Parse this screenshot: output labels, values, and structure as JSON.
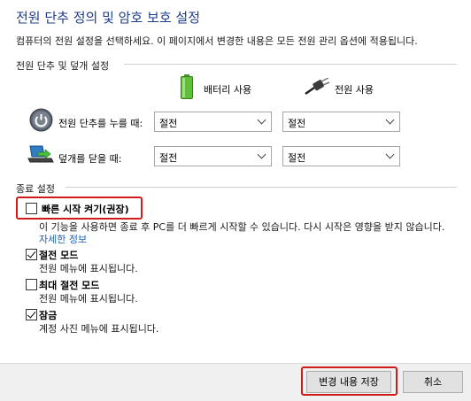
{
  "header": {
    "title": "전원 단추 정의 및 암호 보호 설정",
    "subtitle": "컴퓨터의 전원 설정을 선택하세요. 이 페이지에서 변경한 내용은 모든 전원 관리 옵션에 적용됩니다."
  },
  "power_section": {
    "heading": "전원 단추 및 덮개 설정",
    "col_battery": "배터리 사용",
    "col_plugged": "전원 사용",
    "rows": [
      {
        "label": "전원 단추를 누를 때:",
        "battery_value": "절전",
        "plugged_value": "절전",
        "icon": "power-button-icon"
      },
      {
        "label": "덮개를 닫을 때:",
        "battery_value": "절전",
        "plugged_value": "절전",
        "icon": "laptop-lid-icon"
      }
    ]
  },
  "shutdown_section": {
    "heading": "종료 설정",
    "fast_startup": {
      "label": "빠른 시작 켜기(권장)",
      "checked": false,
      "desc": "이 기능을 사용하면 종료 후 PC를 더 빠르게 시작할 수 있습니다. 다시 시작은 영향을 받지 않습니다.",
      "link": "자세한 정보"
    },
    "sleep": {
      "label": "절전 모드",
      "checked": true,
      "desc": "전원 메뉴에 표시됩니다."
    },
    "hibernate": {
      "label": "최대 절전 모드",
      "checked": false,
      "desc": "전원 메뉴에 표시됩니다."
    },
    "lock": {
      "label": "잠금",
      "checked": true,
      "desc": "계정 사진 메뉴에 표시됩니다."
    }
  },
  "footer": {
    "save_label": "변경 내용 저장",
    "cancel_label": "취소"
  },
  "colors": {
    "title": "#1e3e8a",
    "link": "#1a5fb4",
    "highlight": "#d11a1a"
  }
}
